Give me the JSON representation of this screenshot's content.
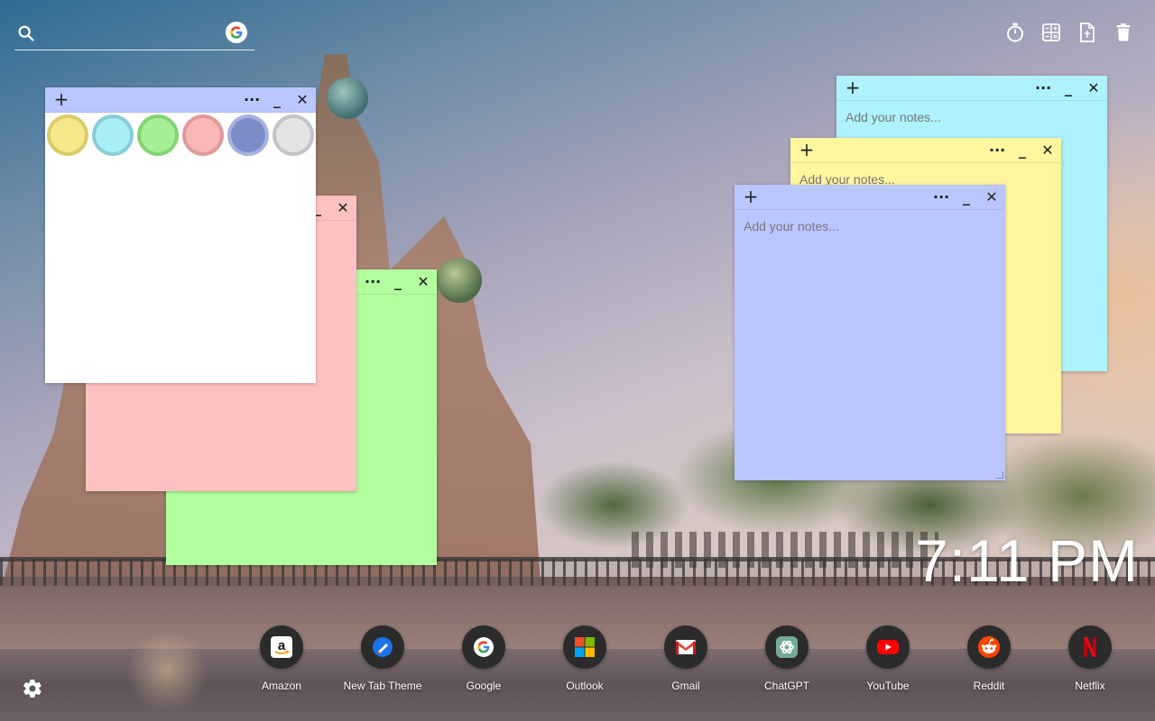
{
  "search": {
    "placeholder": ""
  },
  "top_tools": [
    {
      "name": "timer-icon",
      "label": "Timer"
    },
    {
      "name": "calculator-icon",
      "label": "Calculator"
    },
    {
      "name": "note-page-icon",
      "label": "Notes"
    },
    {
      "name": "trash-icon",
      "label": "Trash"
    }
  ],
  "notes": {
    "placeholder": "Add your notes...",
    "add_symbol": "+",
    "menu_symbol": "···",
    "minimize_symbol": "_",
    "close_symbol": "✕",
    "palette": {
      "colors": [
        "#f6e98c",
        "#aaeef7",
        "#a6ef96",
        "#f9b7b7",
        "#7e8cc8",
        "#e4e4e4"
      ],
      "ring_colors": [
        "#d9cc66",
        "#87cdd8",
        "#84d374",
        "#e09a9a",
        "#a6b1e0",
        "#c4c4c4"
      ]
    },
    "colors": {
      "white": "#ffffff",
      "pink": "#ffc2c2",
      "green": "#b2ff9e",
      "cyan": "#aef2fd",
      "yellow": "#fff69e",
      "blue": "#bac6ff"
    }
  },
  "clock": {
    "time": "7:11 PM"
  },
  "dock": [
    {
      "name": "amazon",
      "label": "Amazon"
    },
    {
      "name": "new-tab-theme",
      "label": "New Tab Theme"
    },
    {
      "name": "google",
      "label": "Google"
    },
    {
      "name": "outlook",
      "label": "Outlook"
    },
    {
      "name": "gmail",
      "label": "Gmail"
    },
    {
      "name": "chatgpt",
      "label": "ChatGPT"
    },
    {
      "name": "youtube",
      "label": "YouTube"
    },
    {
      "name": "reddit",
      "label": "Reddit"
    },
    {
      "name": "netflix",
      "label": "Netflix"
    }
  ]
}
